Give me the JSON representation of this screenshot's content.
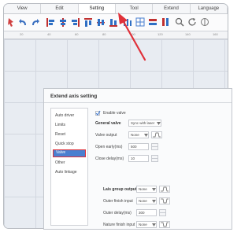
{
  "menu": [
    "View",
    "Edit",
    "Setting",
    "Tool",
    "Extend",
    "Language"
  ],
  "ruler": [
    "20",
    "40",
    "60",
    "80",
    "100",
    "120",
    "140",
    "160"
  ],
  "dialog": {
    "title": "Extend axis setting",
    "nav": [
      "Auto driver",
      "Limits",
      "Reset",
      "Quick stop",
      "Valve",
      "Other",
      "Auto linkage"
    ],
    "selected_nav": "Valve",
    "enable_valve": "Enable valve",
    "general_valve": "General valve",
    "general_valve_value": "Sync with laser",
    "valve_output": "Valve output",
    "valve_output_value": "None",
    "open_early": "Open early(ms)",
    "open_early_value": "500",
    "close_delay": "Close delay(ms)",
    "close_delay_value": "10",
    "lais_group_output": "Lais group output",
    "lais_group_output_value": "None",
    "outer_finish_input": "Outer finish input",
    "outer_finish_input_value": "None",
    "outer_delay": "Outer delay(ms)",
    "outer_delay_value": "300",
    "nature_finish_input": "Nature finish input",
    "nature_finish_input_value": "None"
  },
  "colors": {
    "highlight": "#e0313a",
    "selection": "#4a7fd0"
  }
}
